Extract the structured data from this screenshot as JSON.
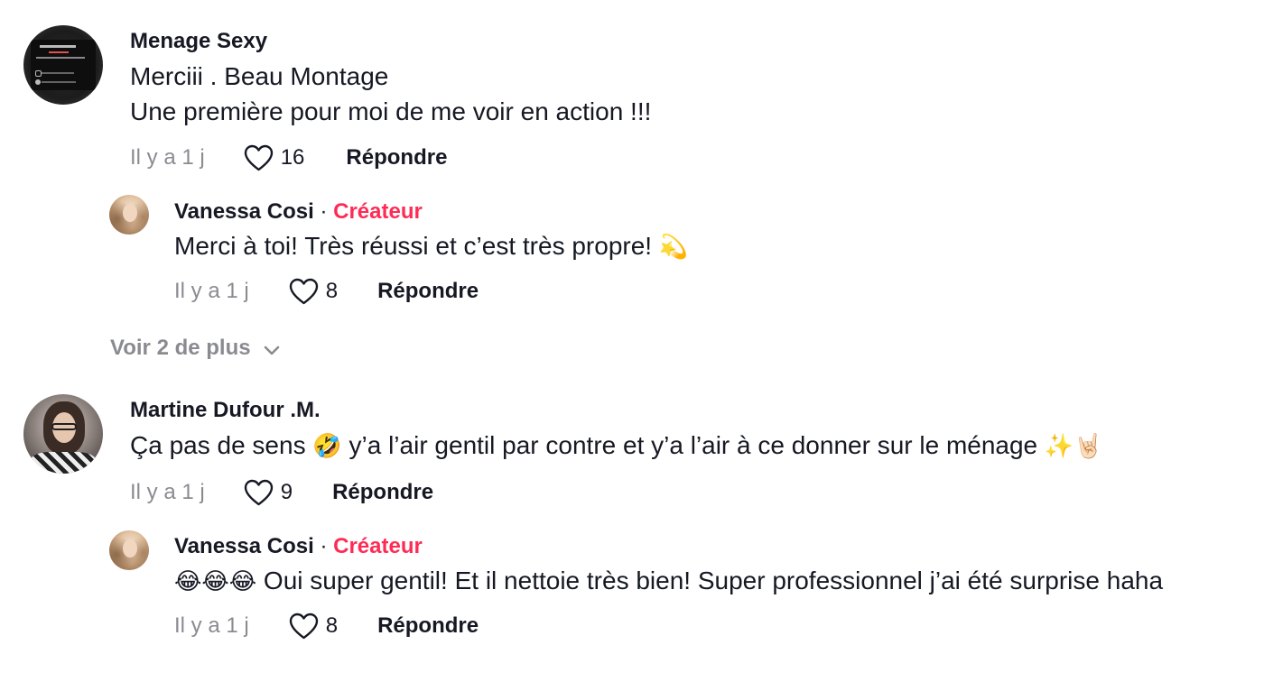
{
  "comments": [
    {
      "username": "Menage Sexy",
      "lines": [
        "Merciii . Beau Montage",
        "Une première pour moi de me voir en action !!!"
      ],
      "time": "Il y a 1 j",
      "likes": "16",
      "reply_label": "Répondre",
      "avatar": "business-card"
    },
    {
      "username": "Vanessa Cosi",
      "separator": "·",
      "badge": "Créateur",
      "text": "Merci à toi! Très réussi et c’est très propre!",
      "emoji": "💫",
      "time": "Il y a 1 j",
      "likes": "8",
      "reply_label": "Répondre",
      "avatar": "vanessa"
    },
    {
      "username": "Martine Dufour .M.",
      "text_a": "Ça pas de sens",
      "emoji_a": "🤣",
      "text_b": "y’a l’air gentil par contre et y’a l’air à ce donner sur le ménage",
      "emoji_b": "✨🤘🏻",
      "time": "Il y a 1 j",
      "likes": "9",
      "reply_label": "Répondre",
      "avatar": "martine"
    },
    {
      "username": "Vanessa Cosi",
      "separator": "·",
      "badge": "Créateur",
      "emoji_prefix": "😂😂😂",
      "text": "Oui super gentil! Et il nettoie très bien! Super professionnel j’ai été surprise haha",
      "time": "Il y a 1 j",
      "likes": "8",
      "reply_label": "Répondre",
      "avatar": "vanessa"
    }
  ],
  "view_more": {
    "label": "Voir 2 de plus"
  },
  "colors": {
    "text": "#161823",
    "muted": "#8a8b91",
    "creator": "#fe2c55"
  },
  "icons": {
    "like": "heart-outline-icon",
    "expand": "chevron-down-icon"
  }
}
